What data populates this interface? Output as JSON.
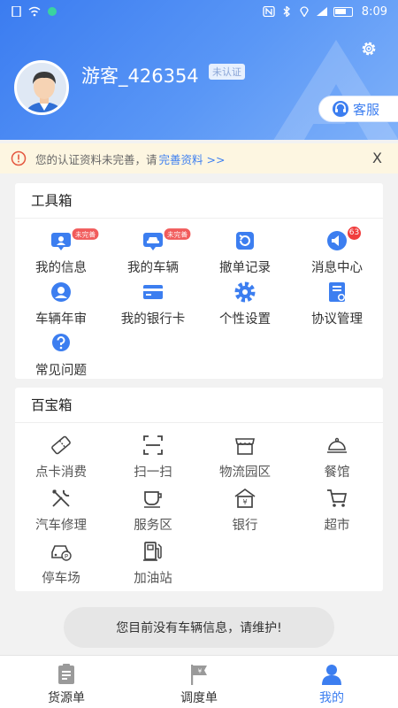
{
  "status_bar": {
    "time": "8:09"
  },
  "profile": {
    "username": "游客_426354",
    "cert_status": "未认证",
    "service_label": "客服"
  },
  "notice": {
    "text": "您的认证资料未完善，请",
    "link": "完善资料 >>",
    "close": "X"
  },
  "toolbox": {
    "title": "工具箱",
    "items": [
      {
        "label": "我的信息",
        "icon": "id-card-icon",
        "tag": "未完善"
      },
      {
        "label": "我的车辆",
        "icon": "car-icon",
        "tag": "未完善"
      },
      {
        "label": "撤单记录",
        "icon": "refresh-icon"
      },
      {
        "label": "消息中心",
        "icon": "speaker-icon",
        "badge": "63"
      },
      {
        "label": "车辆年审",
        "icon": "user-badge-icon"
      },
      {
        "label": "我的银行卡",
        "icon": "bank-card-icon"
      },
      {
        "label": "个性设置",
        "icon": "gear-icon"
      },
      {
        "label": "协议管理",
        "icon": "document-icon"
      },
      {
        "label": "常见问题",
        "icon": "question-icon"
      }
    ]
  },
  "treasure": {
    "title": "百宝箱",
    "items": [
      {
        "label": "点卡消费",
        "icon": "ticket-icon"
      },
      {
        "label": "扫一扫",
        "icon": "scan-icon"
      },
      {
        "label": "物流园区",
        "icon": "store-icon"
      },
      {
        "label": "餐馆",
        "icon": "dish-icon"
      },
      {
        "label": "汽车修理",
        "icon": "wrench-icon"
      },
      {
        "label": "服务区",
        "icon": "cup-icon"
      },
      {
        "label": "银行",
        "icon": "bank-icon"
      },
      {
        "label": "超市",
        "icon": "cart-icon"
      },
      {
        "label": "停车场",
        "icon": "parking-icon"
      },
      {
        "label": "加油站",
        "icon": "fuel-icon"
      }
    ]
  },
  "toast": "您目前没有车辆信息，请维护!",
  "tabbar": {
    "items": [
      {
        "label": "货源单",
        "icon": "clipboard-icon"
      },
      {
        "label": "调度单",
        "icon": "dispatch-flag-icon"
      },
      {
        "label": "我的",
        "icon": "person-icon",
        "active": true
      }
    ]
  },
  "colors": {
    "primary": "#3c7ef0",
    "badge_red": "#f15b5b",
    "notice_bg": "#fdf6e1"
  }
}
